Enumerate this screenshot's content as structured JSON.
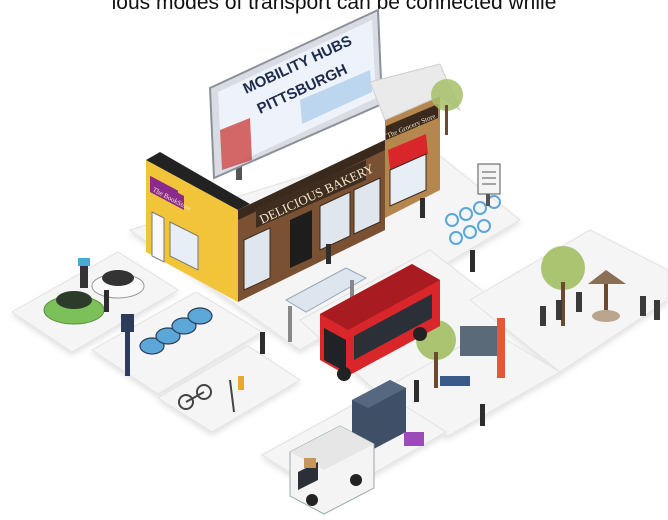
{
  "caption": "ious modes of transport can be connected while",
  "billboard": {
    "line1": "MOBILITY HUBS",
    "line2": "PITTSBURGH"
  },
  "stores": {
    "bakery": "DELICIOUS BAKERY",
    "bookstore": "The BookStore",
    "grocer": "The Grocery Store"
  },
  "colors": {
    "bus": "#d8262b",
    "building_yellow": "#f2c43a",
    "building_brown": "#6b4a2f",
    "tile": "#f3f3f3",
    "bike_share": "#5aa7d8"
  }
}
